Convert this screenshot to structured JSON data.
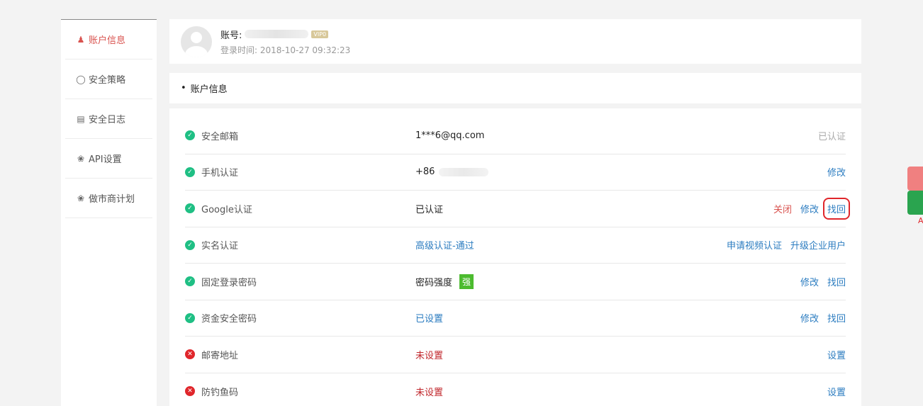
{
  "sidebar": {
    "items": [
      {
        "label": "账户信息",
        "icon": "user-icon",
        "active": true
      },
      {
        "label": "安全策略",
        "icon": "bulb-icon",
        "active": false
      },
      {
        "label": "安全日志",
        "icon": "doc-icon",
        "active": false
      },
      {
        "label": "API设置",
        "icon": "nodes-icon",
        "active": false
      },
      {
        "label": "做市商计划",
        "icon": "nodes-icon",
        "active": false
      }
    ]
  },
  "header": {
    "account_label": "账号:",
    "vip_badge": "VIP0",
    "login_time": "登录时间: 2018-10-27 09:32:23"
  },
  "section": {
    "title": "账户信息"
  },
  "rows": [
    {
      "label": "安全邮箱",
      "value": "1***6@qq.com",
      "status": "ok",
      "actions": [
        "已认证"
      ]
    },
    {
      "label": "手机认证",
      "value": "+86",
      "status": "ok",
      "actions": [
        "修改"
      ]
    },
    {
      "label": "Google认证",
      "value": "已认证",
      "status": "ok",
      "actions": [
        "关闭",
        "修改",
        "找回"
      ]
    },
    {
      "label": "实名认证",
      "value": "高级认证-通过",
      "status": "ok",
      "actions": [
        "申请视频认证",
        "升级企业用户"
      ]
    },
    {
      "label": "固定登录密码",
      "value": "密码强度",
      "strength": "强",
      "status": "ok",
      "actions": [
        "修改",
        "找回"
      ]
    },
    {
      "label": "资金安全密码",
      "value": "已设置",
      "status": "ok",
      "actions": [
        "修改",
        "找回"
      ]
    },
    {
      "label": "邮寄地址",
      "value": "未设置",
      "status": "bad",
      "actions": [
        "设置"
      ]
    },
    {
      "label": "防钓鱼码",
      "value": "未设置",
      "status": "bad",
      "actions": [
        "设置"
      ]
    }
  ],
  "colors": {
    "accent": "#d9534f",
    "link": "#2b7cc0",
    "ok": "#1fbf84",
    "error": "#e0262b"
  },
  "float_label": "A"
}
